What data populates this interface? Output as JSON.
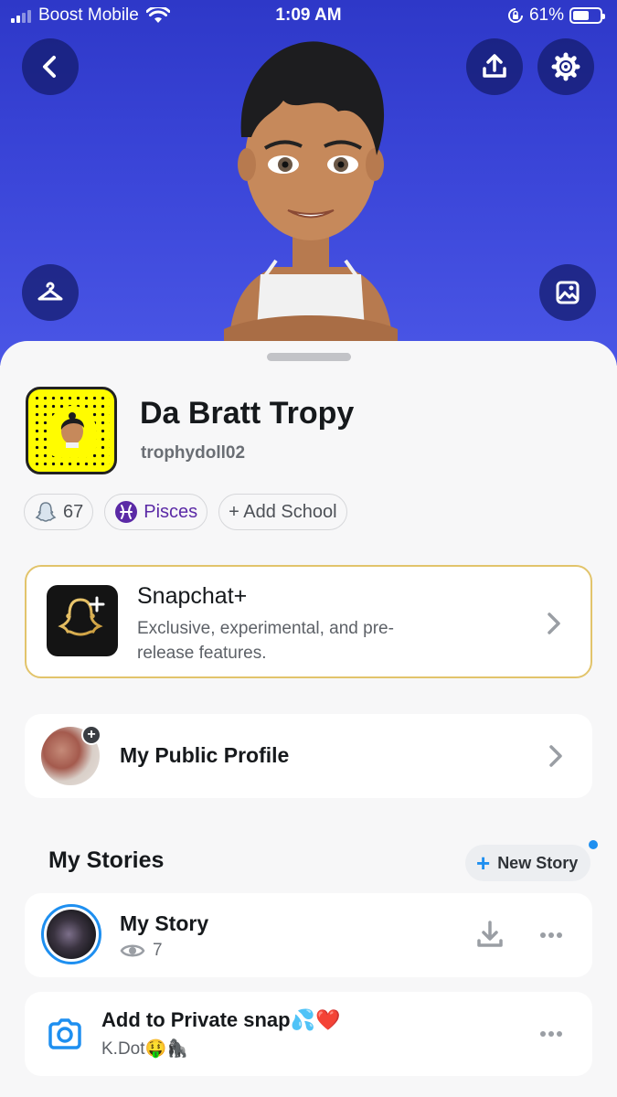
{
  "status_bar": {
    "carrier": "Boost Mobile",
    "time": "1:09 AM",
    "battery": "61%",
    "battery_level": 0.61
  },
  "header": {
    "back_icon": "chevron-left-icon",
    "share_icon": "upload-icon",
    "settings_icon": "gear-icon",
    "wardrobe_icon": "hanger-icon",
    "background_icon": "image-icon"
  },
  "profile": {
    "display_name": "Da Bratt Tropy",
    "username": "trophydoll02",
    "chips": {
      "score": "67",
      "zodiac": "Pisces",
      "school": "+ Add School"
    }
  },
  "snapchat_plus": {
    "title": "Snapchat+",
    "description": "Exclusive, experimental, and pre-release features."
  },
  "public_profile": {
    "label": "My Public Profile",
    "add_icon": "+"
  },
  "stories": {
    "section_title": "My Stories",
    "new_story_label": "New Story",
    "new_story_plus": "+",
    "items": [
      {
        "title": "My Story",
        "views": "7"
      },
      {
        "title": "Add to Private snap💦❤️",
        "subtitle": "K.Dot🤑🦍"
      }
    ]
  },
  "colors": {
    "accent": "#1e8ff0",
    "hero_top": "#2e38c8",
    "snapcode": "#fffc00",
    "zodiac": "#5b2aa6",
    "gold_border": "#e2c46b"
  }
}
